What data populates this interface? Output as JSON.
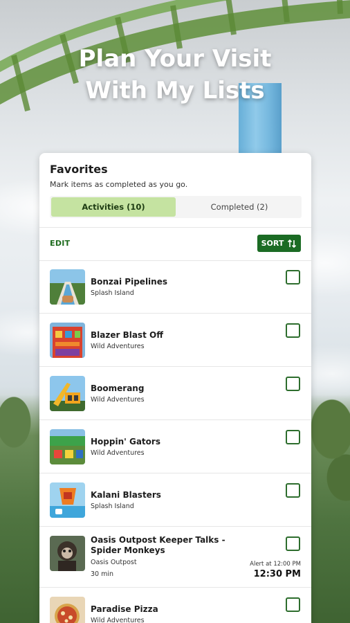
{
  "headline": {
    "line1": "Plan Your Visit",
    "line2": "With My Lists"
  },
  "card": {
    "title": "Favorites",
    "subtitle": "Mark items as completed as you go.",
    "tabs": [
      {
        "label": "Activities (10)",
        "active": true
      },
      {
        "label": "Completed (2)",
        "active": false
      }
    ],
    "edit_label": "EDIT",
    "sort_label": "SORT"
  },
  "items": [
    {
      "title": "Bonzai Pipelines",
      "area": "Splash Island",
      "thumb": "waterslide",
      "checked": false
    },
    {
      "title": "Blazer Blast Off",
      "area": "Wild Adventures",
      "thumb": "ride-tower",
      "checked": false
    },
    {
      "title": "Boomerang",
      "area": "Wild Adventures",
      "thumb": "coaster",
      "checked": false
    },
    {
      "title": "Hoppin' Gators",
      "area": "Wild Adventures",
      "thumb": "kiddie-ride",
      "checked": false
    },
    {
      "title": "Kalani Blasters",
      "area": "Splash Island",
      "thumb": "water-play",
      "checked": false
    },
    {
      "title": "Oasis Outpost Keeper Talks - Spider Monkeys",
      "area": "Oasis Outpost",
      "duration": "30 min",
      "alert": "Alert at 12:00 PM",
      "time": "12:30 PM",
      "thumb": "monkey",
      "checked": false
    },
    {
      "title": "Paradise Pizza",
      "area": "Wild Adventures",
      "thumb": "pizza",
      "checked": false
    }
  ],
  "colors": {
    "accent_green": "#1b6b24",
    "tab_active": "#c5e3a1",
    "checkbox_border": "#2d6d2d"
  }
}
